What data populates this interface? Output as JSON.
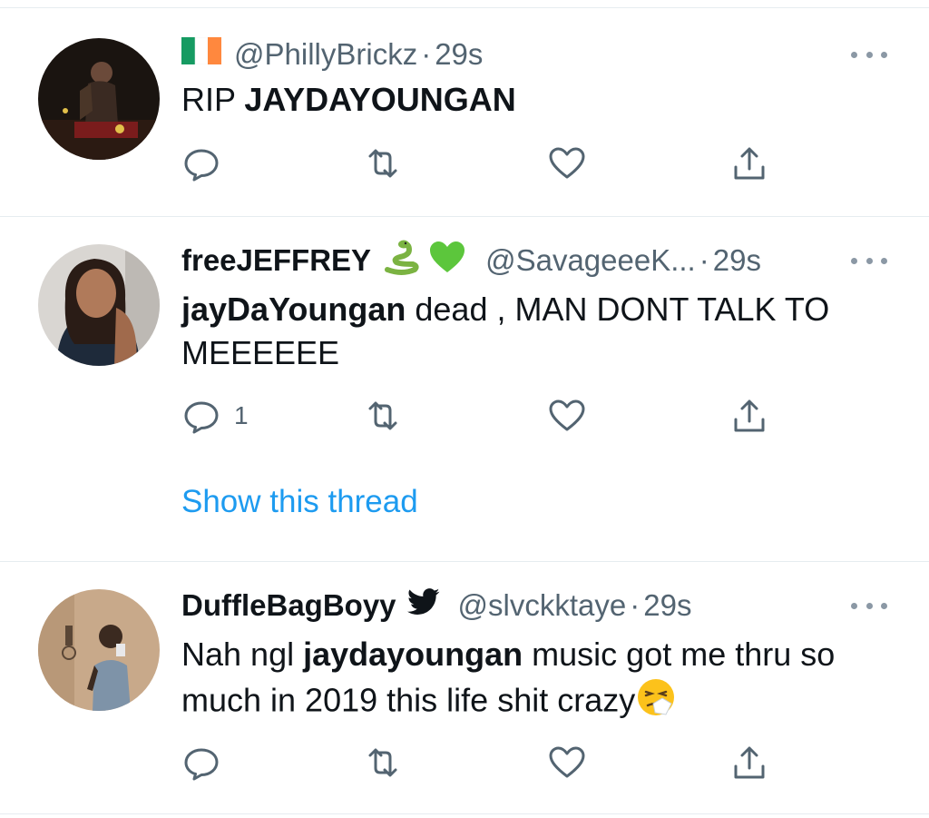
{
  "tweets": [
    {
      "handle": "@PhillyBrickz",
      "dot": "·",
      "time": "29s",
      "body_prefix": "RIP ",
      "body_bold": "JAYDAYOUNGAN"
    },
    {
      "name": "freeJEFFREY",
      "handle": "@SavageeeK...",
      "dot": "·",
      "time": "29s",
      "body_bold": "jayDaYoungan",
      "body_rest": " dead , MAN DONT TALK TO MEEEEEE",
      "reply_count": "1",
      "show_thread": "Show this thread"
    },
    {
      "name": "DuffleBagBoyy",
      "handle": "@slvckktaye",
      "dot": "·",
      "time": "29s",
      "body_prefix": "Nah ngl ",
      "body_bold": "jaydayoungan",
      "body_rest": " music got me thru so much in 2019 this life shit crazy"
    }
  ],
  "colors": {
    "accent": "#1d9bf0",
    "muted": "#536471",
    "text": "#0f1419",
    "divider": "#e6ecf0"
  },
  "icons": [
    "reply-icon",
    "retweet-icon",
    "like-icon",
    "share-icon",
    "more-icon",
    "irish-flag-icon",
    "snake-emoji-icon",
    "green-heart-emoji-icon",
    "twitter-bird-icon",
    "sneezing-face-emoji-icon"
  ]
}
